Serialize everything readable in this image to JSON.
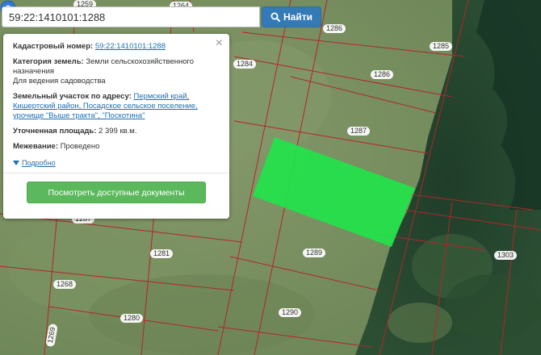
{
  "search": {
    "value": "59:22:1410101:1288",
    "button_label": "Найти",
    "icon": "search-icon"
  },
  "popup": {
    "cadastral_label": "Кадастровый номер:",
    "cadastral_value": "59:22:1410101:1288",
    "category_label": "Категория земель:",
    "category_value": "Земли сельскохозяйственного назначения",
    "usage": "Для ведения садоводства",
    "address_label": "Земельный участок по адресу:",
    "address_value": "Пермский край, Кишертский район, Посадское сельское поселение, урочище \"Выше тракта\", \"Поскотина\"",
    "area_label": "Уточненная площадь:",
    "area_value": "2 399 кв.м.",
    "survey_label": "Межевание:",
    "survey_value": "Проведено",
    "more_label": "Подробно",
    "docs_button": "Посмотреть доступные документы",
    "close_icon": "close-icon"
  },
  "map": {
    "parcel_labels": [
      {
        "id": "p1259",
        "text": "1259"
      },
      {
        "id": "p1264",
        "text": "1264"
      },
      {
        "id": "p1286a",
        "text": "1286"
      },
      {
        "id": "p1285",
        "text": "1285"
      },
      {
        "id": "p1284",
        "text": "1284"
      },
      {
        "id": "p1286b",
        "text": "1286"
      },
      {
        "id": "p1287a",
        "text": "1287"
      },
      {
        "id": "p1287b",
        "text": "1287"
      },
      {
        "id": "p1281",
        "text": "1281"
      },
      {
        "id": "p1289",
        "text": "1289"
      },
      {
        "id": "p1303",
        "text": "1303"
      },
      {
        "id": "p1268",
        "text": "1268"
      },
      {
        "id": "p1290",
        "text": "1290"
      },
      {
        "id": "p1280",
        "text": "1280"
      },
      {
        "id": "p1269",
        "text": "1269"
      }
    ],
    "selected_parcel_color": "#22e34b",
    "boundary_color": "#b3262a",
    "marker_color": "#2f7bd2",
    "marker_icon": "map-pin-icon"
  }
}
